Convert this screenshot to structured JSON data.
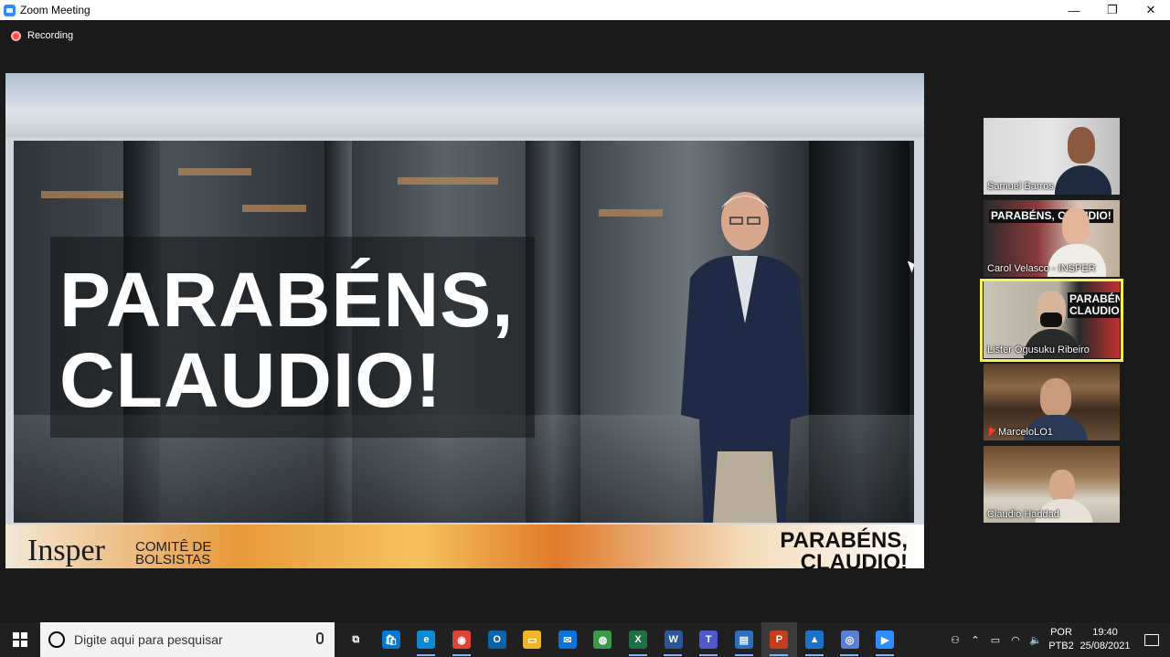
{
  "window": {
    "title": "Zoom Meeting",
    "minimize": "—",
    "restore": "❐",
    "close": "✕"
  },
  "recording": {
    "label": "Recording"
  },
  "share": {
    "headline_line1": "PARABÉNS,",
    "headline_line2": "CLAUDIO!",
    "banner_brand": "Insper",
    "banner_sub_line1": "COMITÊ DE",
    "banner_sub_line2": "BOLSISTAS",
    "banner_right_line1": "PARABÉNS,",
    "banner_right_line2": "CLAUDIO!"
  },
  "participants": [
    {
      "name": "Samuel Barros",
      "muted": false,
      "active": false
    },
    {
      "name": "Carol Velasco - INSPER",
      "muted": false,
      "active": false,
      "overlay_text": "PARABÉNS, CLAUDIO!"
    },
    {
      "name": "Lister Ogusuku Ribeiro",
      "muted": false,
      "active": true,
      "overlay_text": "PARABÉNS, CLAUDIO!"
    },
    {
      "name": "MarceloLO1",
      "muted": true,
      "active": false
    },
    {
      "name": "Claudio Haddad",
      "muted": false,
      "active": false
    }
  ],
  "taskbar": {
    "search_placeholder": "Digite aqui para pesquisar",
    "apps": [
      {
        "name": "task-view",
        "color": "#202020",
        "glyph": "⧉"
      },
      {
        "name": "store",
        "color": "#0078d4",
        "glyph": "🛍"
      },
      {
        "name": "edge",
        "color": "#0c8ad6",
        "glyph": "e"
      },
      {
        "name": "chrome",
        "color": "#db4437",
        "glyph": "◉"
      },
      {
        "name": "outlook",
        "color": "#0a64ad",
        "glyph": "O"
      },
      {
        "name": "explorer",
        "color": "#f0b429",
        "glyph": "▭"
      },
      {
        "name": "mail",
        "color": "#0a74da",
        "glyph": "✉"
      },
      {
        "name": "network-globe",
        "color": "#3b9a4a",
        "glyph": "◍"
      },
      {
        "name": "excel",
        "color": "#1d7044",
        "glyph": "X"
      },
      {
        "name": "word",
        "color": "#2b579a",
        "glyph": "W"
      },
      {
        "name": "teams",
        "color": "#5059c9",
        "glyph": "T"
      },
      {
        "name": "app-window",
        "color": "#2c6fbb",
        "glyph": "▤"
      },
      {
        "name": "powerpoint",
        "color": "#c43e1c",
        "glyph": "P"
      },
      {
        "name": "photos",
        "color": "#1a73c8",
        "glyph": "▲"
      },
      {
        "name": "cortana",
        "color": "#5a7fd6",
        "glyph": "◎"
      },
      {
        "name": "zoom",
        "color": "#2d8cff",
        "glyph": "▶"
      }
    ],
    "language_line1": "POR",
    "language_line2": "PTB2",
    "time": "19:40",
    "date": "25/08/2021"
  }
}
